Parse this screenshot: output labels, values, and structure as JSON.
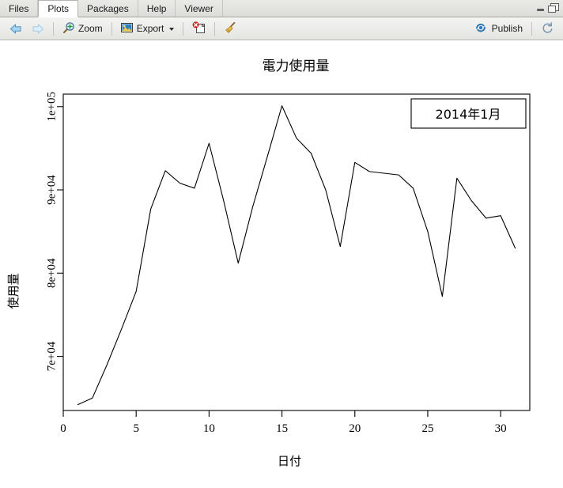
{
  "window": {
    "minimize_label": "Minimize",
    "maximize_label": "Maximize"
  },
  "tabs": [
    {
      "label": "Files",
      "active": false
    },
    {
      "label": "Plots",
      "active": true
    },
    {
      "label": "Packages",
      "active": false
    },
    {
      "label": "Help",
      "active": false
    },
    {
      "label": "Viewer",
      "active": false
    }
  ],
  "toolbar": {
    "back_label": "",
    "forward_label": "",
    "zoom_label": "Zoom",
    "export_label": "Export",
    "remove_label": "",
    "clear_label": "",
    "publish_label": "Publish",
    "refresh_label": ""
  },
  "chart_data": {
    "type": "line",
    "title": "電力使用量",
    "xlabel": "日付",
    "ylabel": "使用量",
    "legend": {
      "position": "top-right",
      "entries": [
        "2014年1月"
      ]
    },
    "grid": false,
    "xlim": [
      0.0,
      32.0
    ],
    "ylim": [
      63500,
      101500
    ],
    "xticks": [
      0,
      5,
      10,
      15,
      20,
      25,
      30
    ],
    "xticklabels": [
      "0",
      "5",
      "10",
      "15",
      "20",
      "25",
      "30"
    ],
    "yticks": [
      70000,
      80000,
      90000,
      100000
    ],
    "yticklabels": [
      "7e+04",
      "8e+04",
      "9e+04",
      "1e+05"
    ],
    "x": [
      1,
      2,
      3,
      4,
      5,
      6,
      7,
      8,
      9,
      10,
      11,
      12,
      13,
      14,
      15,
      16,
      17,
      18,
      19,
      20,
      21,
      22,
      23,
      24,
      25,
      26,
      27,
      28,
      29,
      30,
      31
    ],
    "series": [
      {
        "name": "2014年1月",
        "color": "#000000",
        "values": [
          64200,
          65000,
          69000,
          73300,
          77800,
          87700,
          92300,
          90800,
          90200,
          95600,
          88700,
          81200,
          88000,
          94000,
          100100,
          96200,
          94400,
          90000,
          83200,
          93300,
          92200,
          92000,
          91800,
          90200,
          85000,
          77200,
          91400,
          88700,
          86600,
          86900,
          83000
        ]
      }
    ]
  }
}
